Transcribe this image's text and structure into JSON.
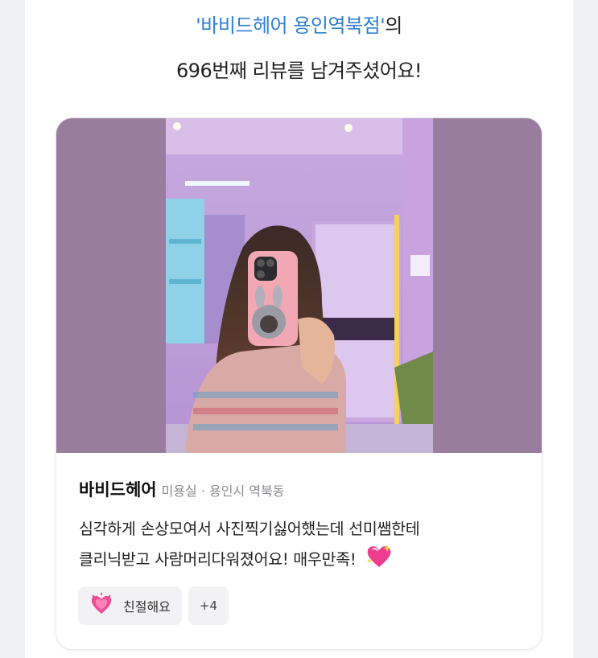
{
  "headline": {
    "store_name": "'바비드헤어 용인역북점'",
    "suffix": "의",
    "line2": "696번째 리뷰를 남겨주셨어요!"
  },
  "card": {
    "shop_name": "바비드헤어",
    "shop_meta": "미용실 · 용인시 역북동",
    "review_line1": "심각하게 손상모여서 사진찍기싫어했는데 선미쌤한테",
    "review_line2": "클리닉받고 사람머리다워졌어요! 매우만족!",
    "review_emoji": "sparkling-heart-icon",
    "tags": [
      {
        "label": "친절해요",
        "icon": "growing-heart-icon"
      }
    ],
    "more_tags": "+4"
  },
  "colors": {
    "accent": "#2f7fd6",
    "photo_bg": "#9a7d9e"
  }
}
